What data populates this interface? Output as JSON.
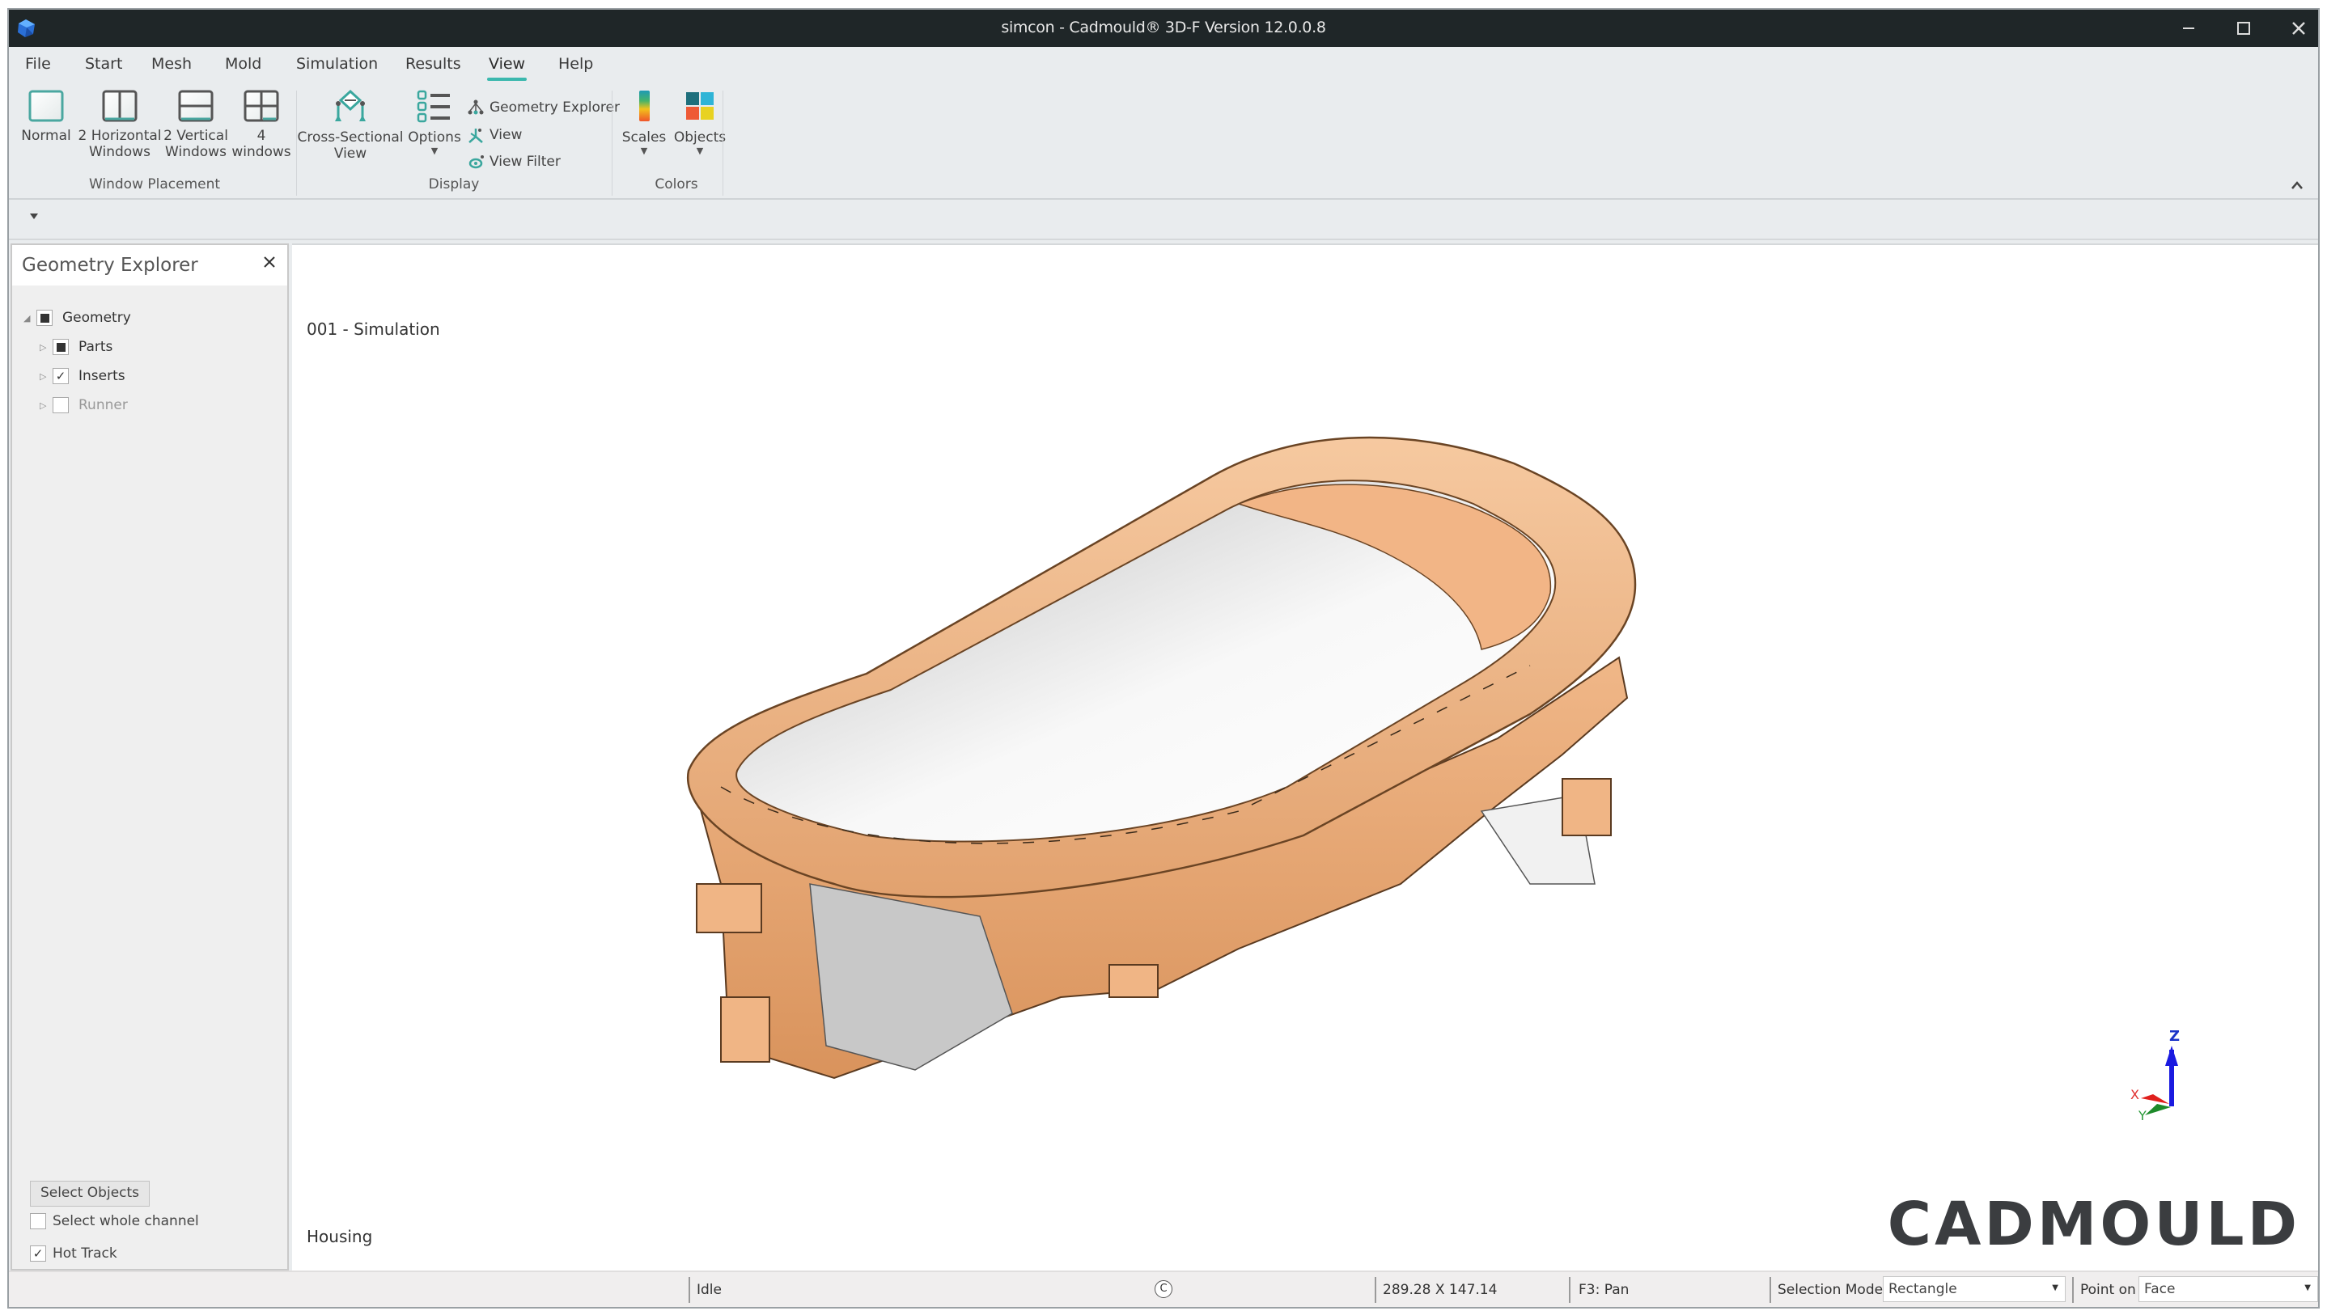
{
  "window": {
    "title": "simcon - Cadmould® 3D-F Version 12.0.0.8",
    "controls": [
      "minimize",
      "maximize",
      "close"
    ]
  },
  "menu": {
    "tabs": [
      "File",
      "Start",
      "Mesh",
      "Mold",
      "Simulation",
      "Results",
      "View",
      "Help"
    ],
    "active": "View"
  },
  "ribbon": {
    "groups": {
      "window_placement": {
        "label": "Window Placement",
        "buttons": [
          {
            "line1": "Normal",
            "line2": ""
          },
          {
            "line1": "2 Horizontal",
            "line2": "Windows"
          },
          {
            "line1": "2 Vertical",
            "line2": "Windows"
          },
          {
            "line1": "4",
            "line2": "windows"
          }
        ]
      },
      "display": {
        "label": "Display",
        "cross_section": {
          "line1": "Cross-Sectional",
          "line2": "View"
        },
        "options": {
          "label": "Options"
        },
        "small_buttons": [
          "Geometry Explorer",
          "View",
          "View Filter"
        ]
      },
      "colors": {
        "label": "Colors",
        "buttons": [
          "Scales",
          "Objects"
        ]
      }
    },
    "colors": {
      "teal": "#3bb8ae",
      "scale_gradient": [
        "#1f9ab5",
        "#44b36b",
        "#f2c21b",
        "#f0542b"
      ],
      "objects_tiles": [
        "#1e6f7c",
        "#2fb4d6",
        "#ee5a36",
        "#e8d221"
      ]
    }
  },
  "explorer": {
    "title": "Geometry Explorer",
    "tree": [
      {
        "label": "Geometry",
        "state": "partial",
        "expanded": true,
        "level": 0,
        "disabled": false
      },
      {
        "label": "Parts",
        "state": "partial",
        "expanded": false,
        "level": 1,
        "disabled": false
      },
      {
        "label": "Inserts",
        "state": "checked",
        "expanded": false,
        "level": 1,
        "disabled": false
      },
      {
        "label": "Runner",
        "state": "unchecked",
        "expanded": false,
        "level": 1,
        "disabled": true
      }
    ],
    "select_button": "Select Objects",
    "options": [
      {
        "label": "Select whole channel",
        "checked": false
      },
      {
        "label": "Hot Track",
        "checked": true
      }
    ]
  },
  "viewport": {
    "simulation_label": "001 - Simulation",
    "part_label": "Housing",
    "logo": "CADMOULD",
    "axes": {
      "x": "X",
      "y": "Y",
      "z": "Z"
    },
    "model_colors": {
      "part": "#f2b98a",
      "part_shade": "#d99560",
      "insert": "#f4f4f4",
      "insert_shade": "#c9c9c9"
    }
  },
  "statusbar": {
    "status": "Idle",
    "dimensions": "289.28 X 147.14",
    "hint": "F3: Pan",
    "selection_mode_label": "Selection Mode",
    "selection_mode_value": "Rectangle",
    "point_on_label": "Point on",
    "point_on_value": "Face"
  }
}
